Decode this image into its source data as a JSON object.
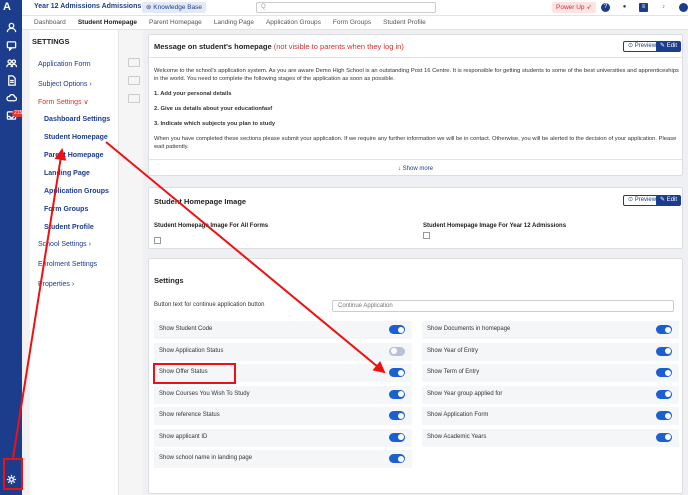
{
  "topbar": {
    "school_select": "Year 12 Admissions Admissions Y...",
    "knowledge_base": "Knowledge Base",
    "search_placeholder": "Q",
    "power_up": "Power Up"
  },
  "tabs": [
    "Dashboard",
    "Student Homepage",
    "Parent Homepage",
    "Landing Page",
    "Application Groups",
    "Form Groups",
    "Student Profile"
  ],
  "active_tab": "Student Homepage",
  "rail": {
    "badge": "215"
  },
  "sidebar": {
    "title": "SETTINGS",
    "items": [
      {
        "label": "Application Form"
      },
      {
        "label": "Subject Options ›"
      },
      {
        "label": "Form Settings ∨"
      },
      {
        "label": "Dashboard Settings"
      },
      {
        "label": "Student Homepage"
      },
      {
        "label": "Parent Homepage"
      },
      {
        "label": "Landing Page"
      },
      {
        "label": "Application Groups"
      },
      {
        "label": "Form Groups"
      },
      {
        "label": "Student Profile"
      },
      {
        "label": "School Settings ›"
      },
      {
        "label": "Enrolment Settings"
      },
      {
        "label": "Properties ›"
      }
    ]
  },
  "message_card": {
    "title": "Message on student's homepage",
    "warning": "(not visible to parents when they log in)",
    "preview": "Preview",
    "edit": "Edit",
    "intro": "Welcome to the school's application system. As you are aware Demo High School is an outstanding Post 16 Centre. It is responsible for getting students to some of the best universities and apprenticeships in the world. You need to complete the following stages of the application as soon as possible.",
    "step1": "1. Add your personal details",
    "step2": "2. Give us details about your educationfasf",
    "step3": "3. Indicate which subjects you plan to study",
    "outro": "When you have completed these sections please submit your application. If we require any further information we will be in contact. Otherwise, you will be alerted to the decision of your application. Please wait patiently.",
    "show_more": "↓ Show more"
  },
  "image_card": {
    "title": "Student Homepage Image",
    "preview": "Preview",
    "edit": "Edit",
    "label_all": "Student Homepage Image For All Forms",
    "label_y12": "Student Homepage Image For Year 12 Admissions"
  },
  "settings_card": {
    "title": "Settings",
    "button_text_label": "Button text for continue application button",
    "button_text_value": "Continue Application",
    "left_toggles": [
      {
        "label": "Show Student Code",
        "on": true
      },
      {
        "label": "Show Application Status",
        "on": false
      },
      {
        "label": "Show Offer Status",
        "on": true
      },
      {
        "label": "Show Courses You Wish To Study",
        "on": true
      },
      {
        "label": "Show reference Status",
        "on": true
      },
      {
        "label": "Show applicant ID",
        "on": true
      },
      {
        "label": "Show school name in landing page",
        "on": true
      }
    ],
    "right_toggles": [
      {
        "label": "Show Documents in homepage",
        "on": true
      },
      {
        "label": "Show Year of Entry",
        "on": true
      },
      {
        "label": "Show Term of Entry",
        "on": true
      },
      {
        "label": "Show Year group applied for",
        "on": true
      },
      {
        "label": "Show Application Form",
        "on": true
      },
      {
        "label": "Show Academic Years",
        "on": true
      }
    ]
  },
  "colors": {
    "primary": "#1c3d8c",
    "annotation": "#e11111",
    "warning": "#d32f2f"
  }
}
